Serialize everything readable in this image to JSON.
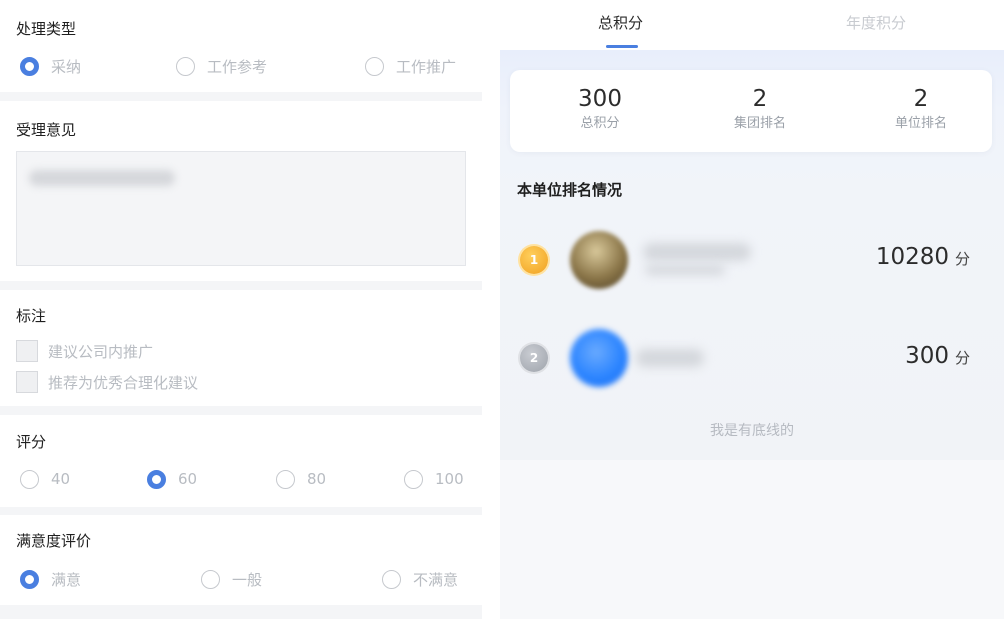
{
  "form": {
    "handle_type": {
      "title": "处理类型",
      "options": [
        {
          "label": "采纳",
          "checked": true
        },
        {
          "label": "工作参考",
          "checked": false
        },
        {
          "label": "工作推广",
          "checked": false
        }
      ]
    },
    "opinion": {
      "title": "受理意见",
      "value_blurred": true
    },
    "mark": {
      "title": "标注",
      "options": [
        {
          "label": "建议公司内推广",
          "checked": false
        },
        {
          "label": "推荐为优秀合理化建议",
          "checked": false
        }
      ]
    },
    "score": {
      "title": "评分",
      "options": [
        {
          "label": "40",
          "checked": false
        },
        {
          "label": "60",
          "checked": true
        },
        {
          "label": "80",
          "checked": false
        },
        {
          "label": "100",
          "checked": false
        }
      ]
    },
    "satisfaction": {
      "title": "满意度评价",
      "options": [
        {
          "label": "满意",
          "checked": true
        },
        {
          "label": "一般",
          "checked": false
        },
        {
          "label": "不满意",
          "checked": false
        }
      ]
    }
  },
  "points": {
    "tabs": [
      {
        "label": "总积分",
        "active": true
      },
      {
        "label": "年度积分",
        "active": false
      }
    ],
    "stats": [
      {
        "value": "300",
        "caption": "总积分"
      },
      {
        "value": "2",
        "caption": "集团排名"
      },
      {
        "value": "2",
        "caption": "单位排名"
      }
    ],
    "ranking_title": "本单位排名情况",
    "ranking": [
      {
        "rank": "1",
        "medal": "gold-medal-icon",
        "score": "10280",
        "unit": "分"
      },
      {
        "rank": "2",
        "medal": "silver-medal-icon",
        "score": "300",
        "unit": "分"
      }
    ],
    "footer_note": "我是有底线的"
  },
  "colors": {
    "accent": "#4a7fe0",
    "muted_text": "#b8bcc2",
    "panel_bg": "#f4f5f7"
  }
}
